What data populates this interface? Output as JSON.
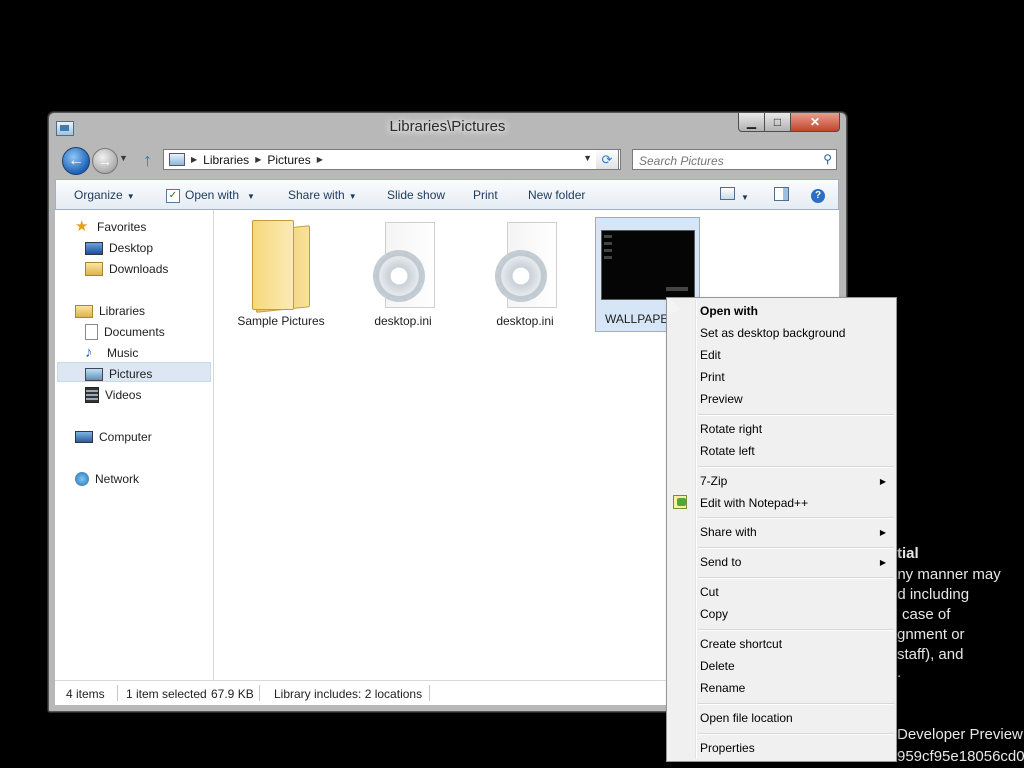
{
  "background_text": [
    {
      "text": "tial"
    },
    {
      "text": "any manner may"
    },
    {
      "text": "nd including"
    },
    {
      "text": "case of"
    },
    {
      "text": "gnment or"
    },
    {
      "text": "staff), and"
    },
    {
      "text": "."
    },
    {
      "text": "Developer Preview"
    },
    {
      "text": "959cf95e18056cd0"
    }
  ],
  "window": {
    "title": "Libraries\\Pictures",
    "caption": {
      "minimize": "▁",
      "maximize": "□",
      "close": "✕"
    }
  },
  "address": {
    "crumbs": [
      "Libraries",
      "Pictures"
    ],
    "separator": "▶"
  },
  "search": {
    "placeholder": "Search Pictures"
  },
  "toolbar": {
    "organize": "Organize",
    "open_with": "Open with",
    "share_with": "Share with",
    "slide_show": "Slide show",
    "print": "Print",
    "new_folder": "New folder"
  },
  "nav": {
    "favorites": "Favorites",
    "desktop": "Desktop",
    "downloads": "Downloads",
    "libraries": "Libraries",
    "documents": "Documents",
    "music": "Music",
    "pictures": "Pictures",
    "videos": "Videos",
    "computer": "Computer",
    "network": "Network"
  },
  "files": [
    {
      "name": "Sample Pictures",
      "icon": "folder-icon"
    },
    {
      "name": "desktop.ini",
      "icon": "settings-file-icon"
    },
    {
      "name": "desktop.ini",
      "icon": "settings-file-icon"
    },
    {
      "name": "WALLPAPER",
      "icon": "image-thumbnail"
    }
  ],
  "status": {
    "items": "4 items",
    "selected": "1 item selected",
    "size": "67.9 KB",
    "library": "Library includes: 2 locations"
  },
  "context_menu": {
    "open_with": "Open with",
    "set_bg": "Set as desktop background",
    "edit": "Edit",
    "print": "Print",
    "preview": "Preview",
    "rotate_right": "Rotate right",
    "rotate_left": "Rotate left",
    "zip": "7-Zip",
    "notepadpp": "Edit with Notepad++",
    "share_with": "Share with",
    "send_to": "Send to",
    "cut": "Cut",
    "copy": "Copy",
    "create_shortcut": "Create shortcut",
    "delete": "Delete",
    "rename": "Rename",
    "open_location": "Open file location",
    "properties": "Properties",
    "submenu_arrow": "▶"
  }
}
